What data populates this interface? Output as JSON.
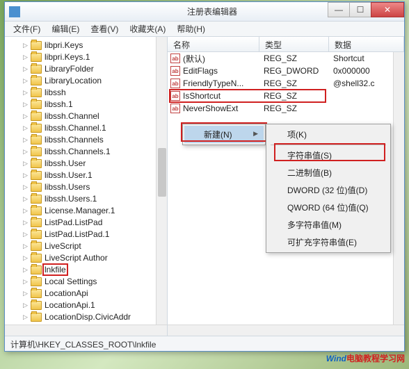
{
  "window": {
    "title": "注册表编辑器"
  },
  "menus": {
    "file": "文件(F)",
    "edit": "编辑(E)",
    "view": "查看(V)",
    "fav": "收藏夹(A)",
    "help": "帮助(H)"
  },
  "tree": [
    "libpri.Keys",
    "libpri.Keys.1",
    "LibraryFolder",
    "LibraryLocation",
    "libssh",
    "libssh.1",
    "libssh.Channel",
    "libssh.Channel.1",
    "libssh.Channels",
    "libssh.Channels.1",
    "libssh.User",
    "libssh.User.1",
    "libssh.Users",
    "libssh.Users.1",
    "License.Manager.1",
    "ListPad.ListPad",
    "ListPad.ListPad.1",
    "LiveScript",
    "LiveScript Author",
    "lnkfile",
    "Local Settings",
    "LocationApi",
    "LocationApi.1",
    "LocationDisp.CivicAddr"
  ],
  "tree_selected_index": 19,
  "list": {
    "headers": {
      "name": "名称",
      "type": "类型",
      "data": "数据"
    },
    "rows": [
      {
        "name": "(默认)",
        "type": "REG_SZ",
        "data": "Shortcut"
      },
      {
        "name": "EditFlags",
        "type": "REG_DWORD",
        "data": "0x000000"
      },
      {
        "name": "FriendlyTypeN...",
        "type": "REG_SZ",
        "data": "@shell32.c"
      },
      {
        "name": "IsShortcut",
        "type": "REG_SZ",
        "data": ""
      },
      {
        "name": "NeverShowExt",
        "type": "REG_SZ",
        "data": ""
      }
    ],
    "highlight_row_index": 3
  },
  "context": {
    "parent": {
      "label": "新建(N)"
    },
    "sub": [
      "项(K)",
      "字符串值(S)",
      "二进制值(B)",
      "DWORD (32 位)值(D)",
      "QWORD (64 位)值(Q)",
      "多字符串值(M)",
      "可扩充字符串值(E)"
    ],
    "sub_highlight_index": 1
  },
  "statusbar": "计算机\\HKEY_CLASSES_ROOT\\lnkfile",
  "watermark": {
    "t1": "Wind",
    "t2": "电脑教程学习网"
  }
}
